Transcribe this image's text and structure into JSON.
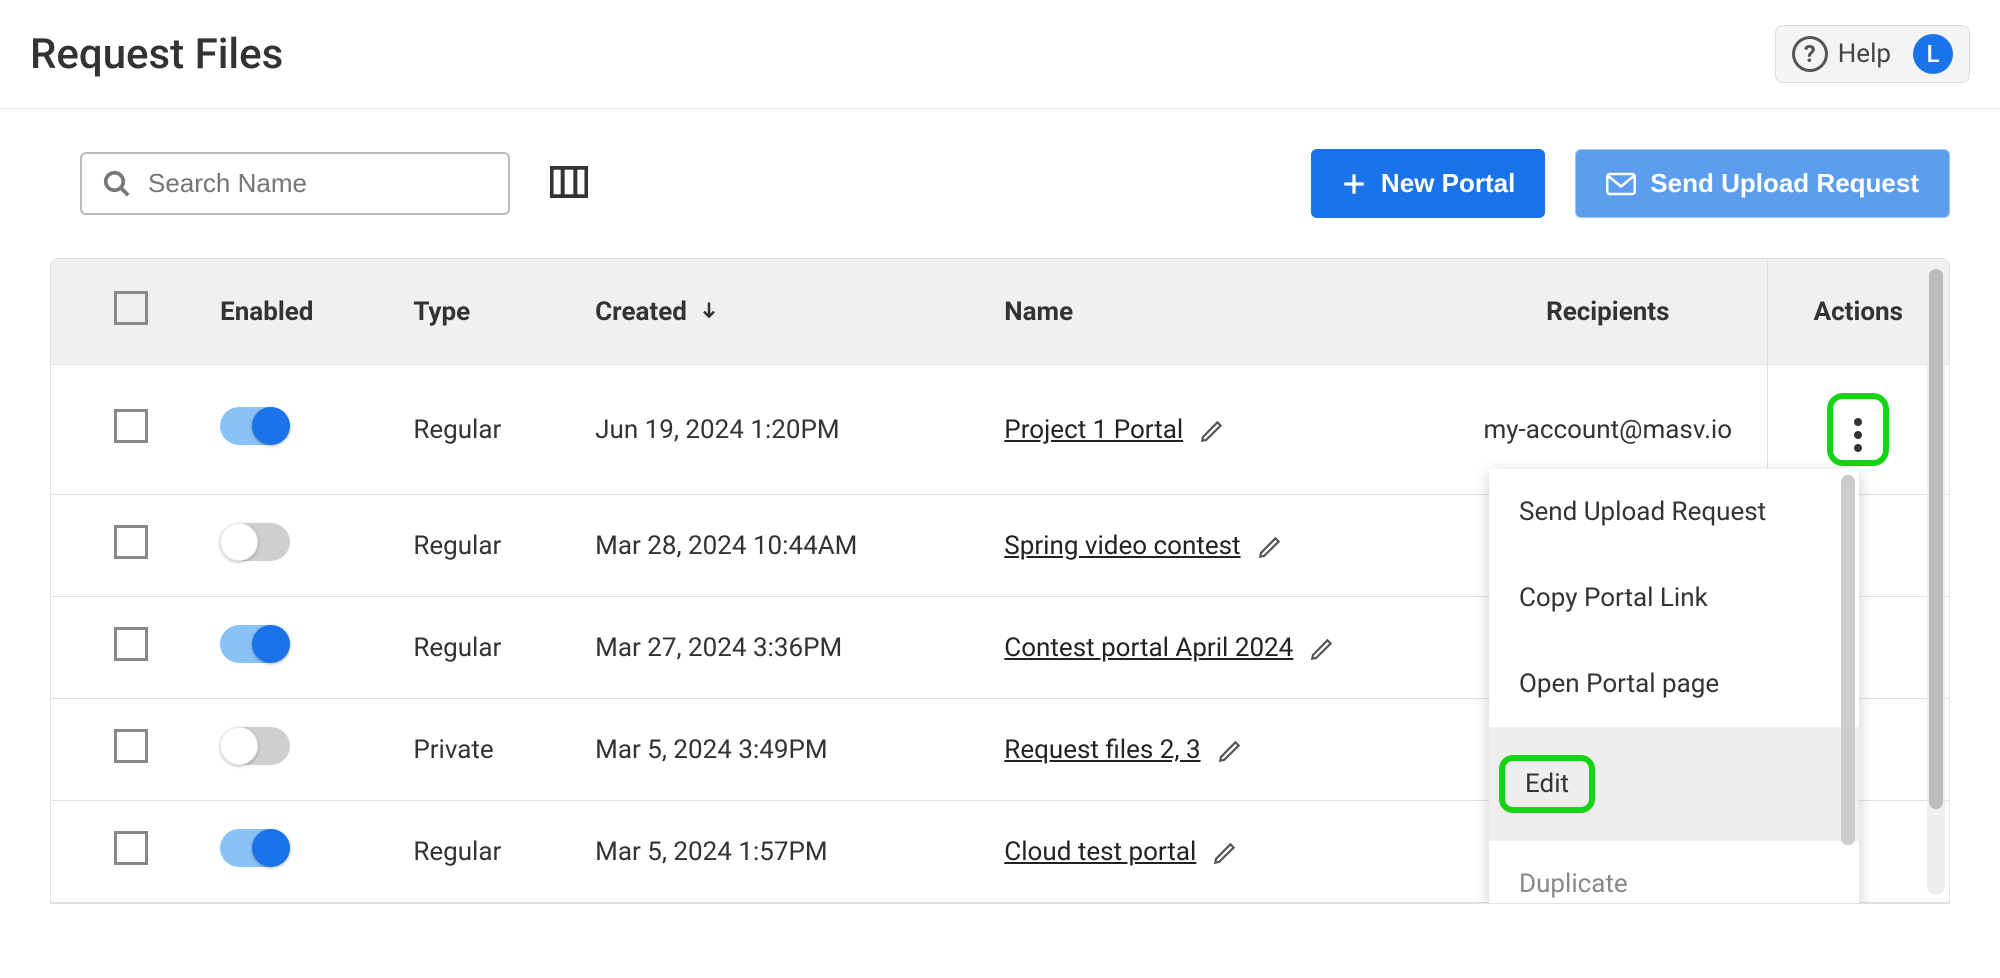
{
  "header": {
    "title": "Request Files",
    "help_label": "Help",
    "avatar_letter": "L"
  },
  "toolbar": {
    "search_placeholder": "Search Name",
    "new_portal_label": "New Portal",
    "send_upload_label": "Send Upload Request"
  },
  "table": {
    "columns": {
      "enabled": "Enabled",
      "type": "Type",
      "created": "Created",
      "name": "Name",
      "recipients": "Recipients",
      "actions": "Actions"
    },
    "rows": [
      {
        "enabled": true,
        "type": "Regular",
        "created": "Jun 19, 2024 1:20PM",
        "name": "Project 1 Portal",
        "recipients": "my-account@masv.io"
      },
      {
        "enabled": false,
        "type": "Regular",
        "created": "Mar 28, 2024 10:44AM",
        "name": "Spring video contest",
        "recipients": ""
      },
      {
        "enabled": true,
        "type": "Regular",
        "created": "Mar 27, 2024 3:36PM",
        "name": "Contest portal April 2024",
        "recipients": ""
      },
      {
        "enabled": false,
        "type": "Private",
        "created": "Mar 5, 2024 3:49PM",
        "name": "Request files 2, 3",
        "recipients": ""
      },
      {
        "enabled": true,
        "type": "Regular",
        "created": "Mar 5, 2024 1:57PM",
        "name": "Cloud test portal",
        "recipients": ""
      }
    ]
  },
  "dropdown": {
    "items": {
      "send": "Send Upload Request",
      "copy": "Copy Portal Link",
      "open": "Open Portal page",
      "edit": "Edit",
      "duplicate": "Duplicate"
    }
  }
}
